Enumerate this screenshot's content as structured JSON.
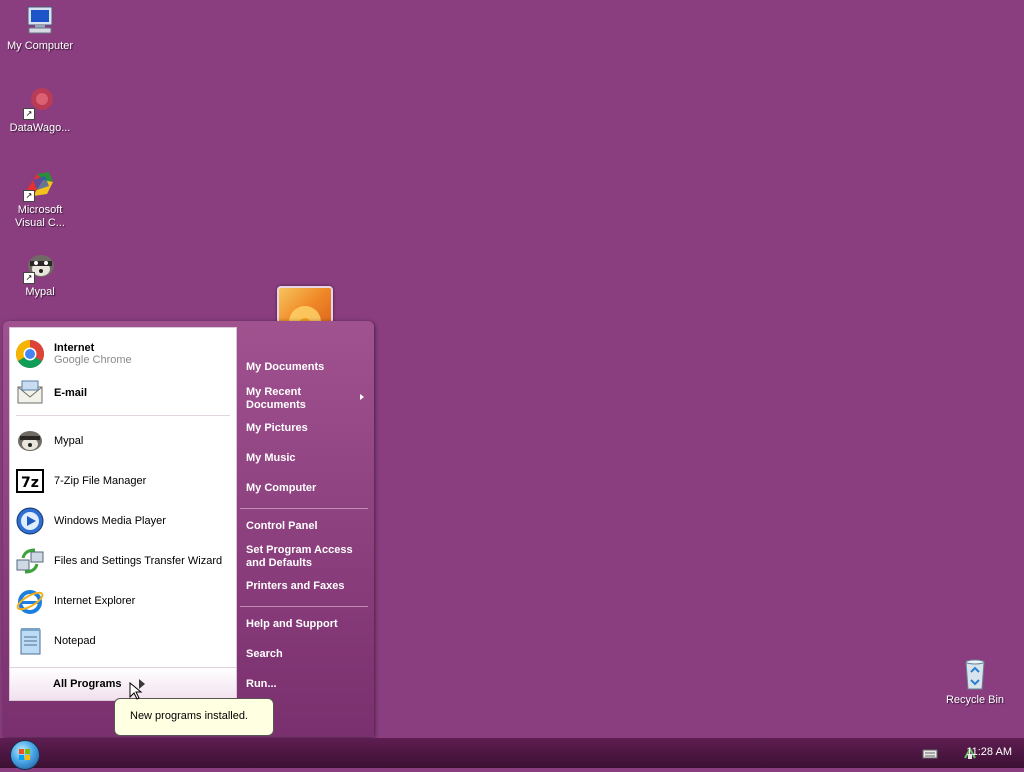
{
  "desktop": {
    "icons": [
      {
        "label": "My Computer"
      },
      {
        "label": "DataWago..."
      },
      {
        "label": "Microsoft Visual C..."
      },
      {
        "label": "Mypal"
      },
      {
        "label": "Recycle Bin"
      }
    ]
  },
  "start_menu": {
    "pinned": [
      {
        "title": "Internet",
        "subtitle": "Google Chrome",
        "icon": "chrome-icon"
      },
      {
        "title": "E-mail",
        "icon": "email-icon"
      }
    ],
    "recent": [
      {
        "label": "Mypal",
        "icon": "mypal-icon"
      },
      {
        "label": "7-Zip File Manager",
        "icon": "7zip-icon"
      },
      {
        "label": "Windows Media Player",
        "icon": "media-player-icon"
      },
      {
        "label": "Files and Settings Transfer Wizard",
        "icon": "transfer-wizard-icon"
      },
      {
        "label": "Internet Explorer",
        "icon": "ie-icon"
      },
      {
        "label": "Notepad",
        "icon": "notepad-icon"
      }
    ],
    "all_programs": "All Programs",
    "right": {
      "my_documents": "My Documents",
      "my_recent_documents": "My Recent Documents",
      "my_pictures": "My Pictures",
      "my_music": "My Music",
      "my_computer": "My Computer",
      "control_panel": "Control Panel",
      "set_program_access": "Set Program Access and Defaults",
      "printers_faxes": "Printers and Faxes",
      "help_support": "Help and Support",
      "search": "Search",
      "run": "Run..."
    }
  },
  "balloon": {
    "text": "New programs installed."
  },
  "taskbar": {
    "clock": "11:28 AM"
  },
  "colors": {
    "desktop": "#8a3e80",
    "taskbar": "#4a1540",
    "menu_right": "#8e4281"
  }
}
